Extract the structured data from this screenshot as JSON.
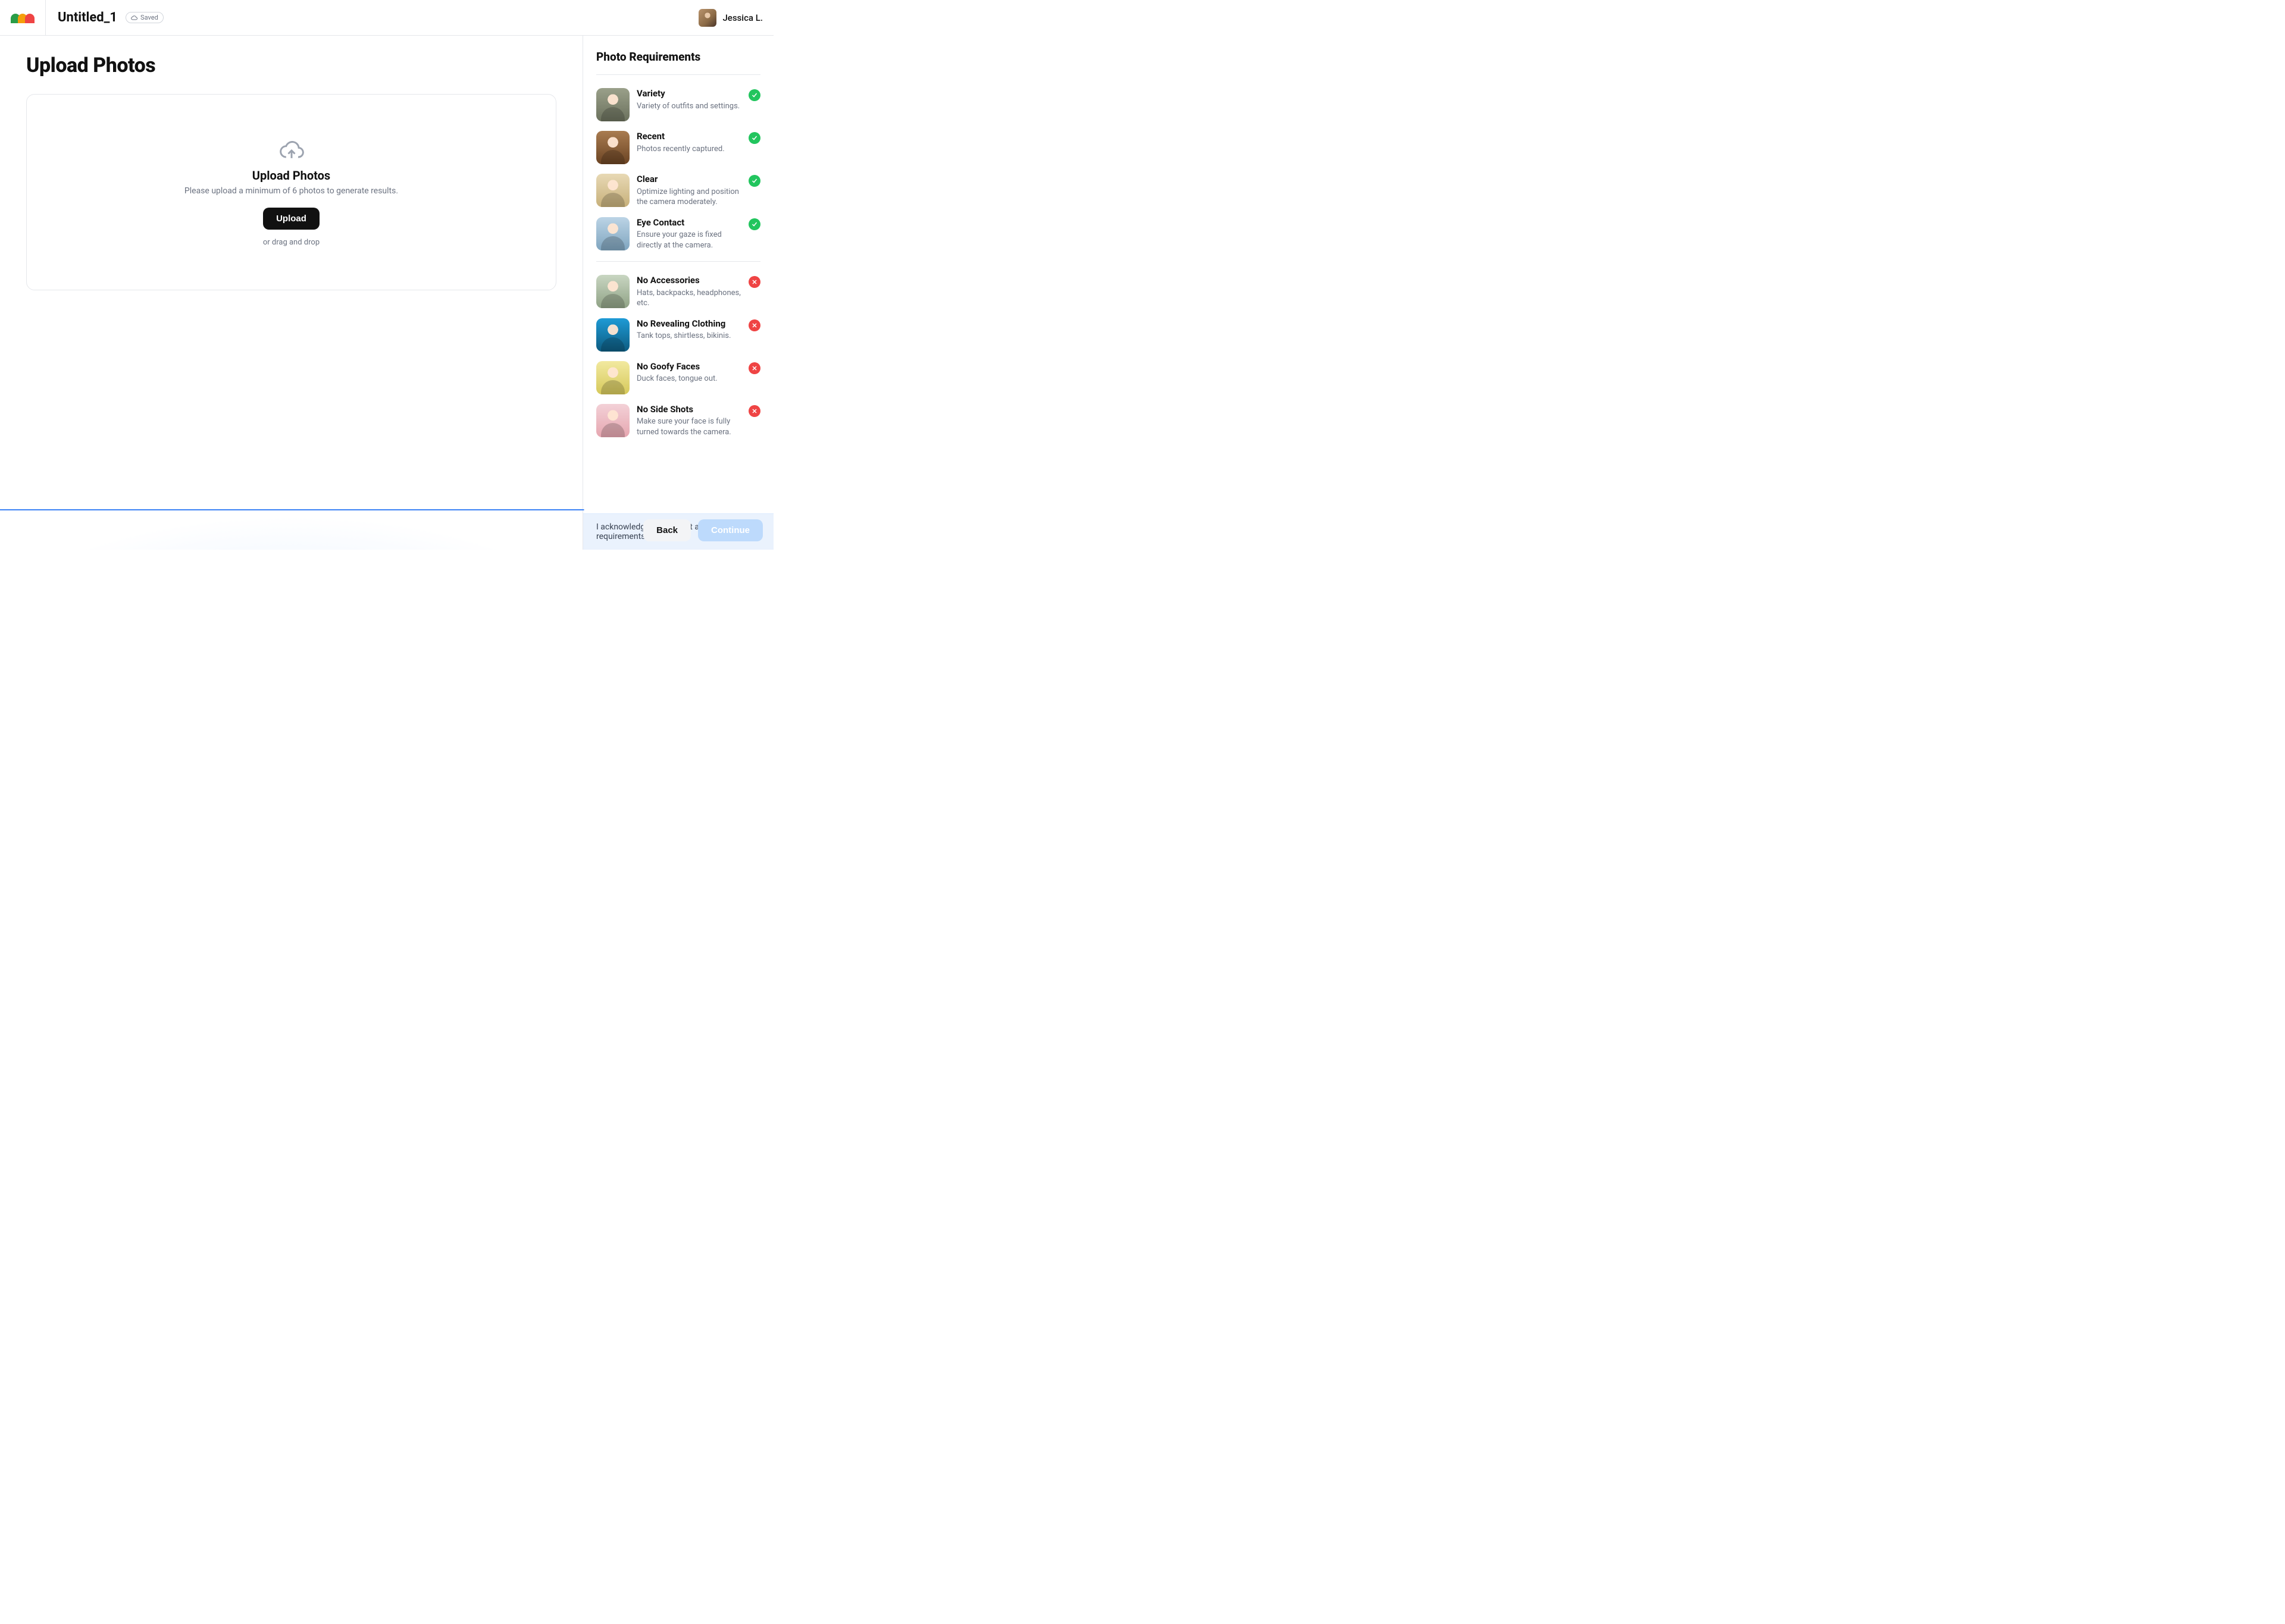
{
  "header": {
    "doc_title": "Untitled_1",
    "saved_label": "Saved",
    "user_name": "Jessica L."
  },
  "main": {
    "heading": "Upload Photos",
    "dropzone_title": "Upload Photos",
    "dropzone_subtitle": "Please upload a minimum of 6 photos to generate results.",
    "upload_button": "Upload",
    "drag_hint": "or drag and drop"
  },
  "sidebar": {
    "title": "Photo Requirements",
    "good": [
      {
        "title": "Variety",
        "desc": "Variety of outfits and settings."
      },
      {
        "title": "Recent",
        "desc": "Photos recently captured."
      },
      {
        "title": "Clear",
        "desc": "Optimize lighting and position the camera moderately."
      },
      {
        "title": "Eye Contact",
        "desc": "Ensure your gaze is fixed directly at the camera."
      }
    ],
    "bad": [
      {
        "title": "No Accessories",
        "desc": "Hats, backpacks, headphones, etc."
      },
      {
        "title": "No Revealing Clothing",
        "desc": "Tank tops, shirtless, bikinis."
      },
      {
        "title": "No Goofy Faces",
        "desc": "Duck faces, tongue out."
      },
      {
        "title": "No Side Shots",
        "desc": "Make sure your face is fully turned towards the camera."
      }
    ],
    "ack_text": "I acknowledge and accept all photo requirements.",
    "ack_checked": true
  },
  "footer": {
    "back_label": "Back",
    "continue_label": "Continue"
  }
}
